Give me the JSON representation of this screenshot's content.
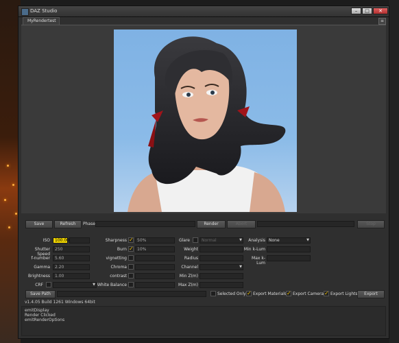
{
  "window": {
    "title": "DAZ Studio"
  },
  "tab": {
    "label": "MyRendertest"
  },
  "toolbar": {
    "save": "Save",
    "refresh": "Refresh",
    "phase_label": "Phase",
    "render": "Render",
    "abort": "Abort",
    "stop": "Stop"
  },
  "settings": {
    "iso": {
      "label": "ISO",
      "value": "100.00"
    },
    "shutter_speed": {
      "label": "Shutter Speed",
      "value": "250"
    },
    "f_number": {
      "label": "f-number",
      "value": "5.60"
    },
    "gamma": {
      "label": "Gamma",
      "value": "2.20"
    },
    "brightness": {
      "label": "Brightness",
      "value": "1.00"
    },
    "crf": {
      "label": "CRF",
      "value": ""
    },
    "sharpness": {
      "label": "Sharpness",
      "value": "50%"
    },
    "burn": {
      "label": "Burn",
      "value": "10%"
    },
    "vignetting": {
      "label": "vignetting"
    },
    "chroma": {
      "label": "Chroma"
    },
    "contrast": {
      "label": "contrast"
    },
    "white_balance": {
      "label": "White Balance"
    },
    "glare": {
      "label": "Glare",
      "value": "Normal"
    },
    "weight": {
      "label": "Weight"
    },
    "radius": {
      "label": "Radius"
    },
    "channel": {
      "label": "Channel"
    },
    "min_z": {
      "label": "Min Z(m)"
    },
    "max_z": {
      "label": "Max Z(m)"
    },
    "analysis": {
      "label": "Analysis",
      "value": "None"
    },
    "min_klum": {
      "label": "Min k-Lum"
    },
    "max_klum": {
      "label": "Max k-Lum"
    }
  },
  "bottom": {
    "save_path": "Save Path",
    "selected_only": "Selected Only",
    "export_materials": "Export Materials",
    "export_camera": "Export Camera",
    "export_lights": "Export Lights",
    "export": "Export"
  },
  "version": "v1.4.05 Build 1261 Windows 64bit",
  "log": [
    "emitDisplay",
    "Render Clicked",
    "emitRenderOptions"
  ]
}
